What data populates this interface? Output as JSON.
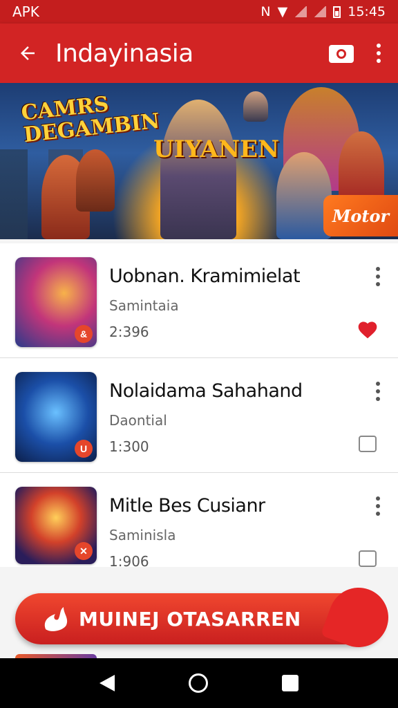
{
  "status_bar": {
    "carrier": "APK",
    "time": "15:45"
  },
  "app_bar": {
    "title": "Indayinasia"
  },
  "banner": {
    "title_line1": "CAMRS",
    "title_line2": "DEGAMBIN",
    "hero_title": "UIYANEN",
    "button_label": "Motor"
  },
  "games": [
    {
      "title": "Uobnan. Kramimielat",
      "subtitle": "Samintaia",
      "meta": "2:396",
      "favorited": true,
      "badge": "&"
    },
    {
      "title": "Nolaidama Sahahand",
      "subtitle": "Daontial",
      "meta": "1:300",
      "favorited": false,
      "badge": "U"
    },
    {
      "title": "Mitle Bes Cusianr",
      "subtitle": "Saminisla",
      "meta": "1:906",
      "favorited": false,
      "badge": "✕"
    }
  ],
  "cta": {
    "label": "MUINEJ OTASARREN"
  },
  "colors": {
    "primary": "#d22424",
    "status_bar": "#c41e1e",
    "heart": "#e0202c"
  }
}
